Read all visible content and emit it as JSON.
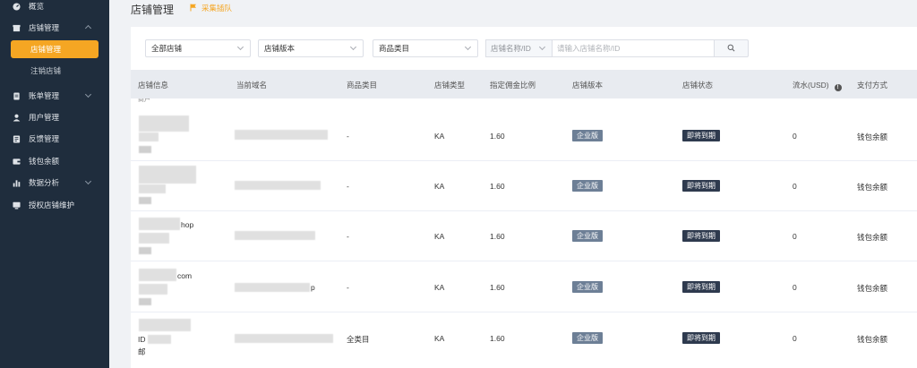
{
  "sidebar": {
    "items": [
      {
        "label": "概览",
        "icon": "dashboard-icon"
      },
      {
        "label": "店铺管理",
        "icon": "store-icon",
        "expanded": true,
        "children": [
          {
            "label": "店铺管理",
            "active": true
          },
          {
            "label": "注销店铺",
            "active": false
          }
        ]
      },
      {
        "label": "账单管理",
        "icon": "bill-icon",
        "expandable": true
      },
      {
        "label": "用户管理",
        "icon": "user-icon"
      },
      {
        "label": "反馈管理",
        "icon": "feedback-icon"
      },
      {
        "label": "钱包余额",
        "icon": "wallet-icon"
      },
      {
        "label": "数据分析",
        "icon": "chart-icon",
        "expandable": true
      },
      {
        "label": "授权店铺维护",
        "icon": "monitor-icon"
      }
    ],
    "active_color": "#f5a623",
    "bg_color": "#1f2d3d"
  },
  "header": {
    "title": "店铺管理",
    "collect_link": "采集插队"
  },
  "filters": {
    "all_stores": "全部店铺",
    "store_version": "店铺版本",
    "product_category": "商品类目",
    "search_type": "店铺名称/ID",
    "search_placeholder": "请输入店铺名称/ID"
  },
  "table": {
    "columns": [
      "店铺信息",
      "当前域名",
      "商品类目",
      "店铺类型",
      "指定佣金比例",
      "店铺版本",
      "店铺状态",
      "流水(USD)",
      "支付方式"
    ],
    "partial_top_text": "商户",
    "rows": [
      {
        "info_suffix": "",
        "domain_suffix": "",
        "category": "-",
        "type": "KA",
        "commission": "1.60",
        "version": "企业版",
        "status": "即将到期",
        "flow": "0",
        "payment": "钱包余额"
      },
      {
        "info_suffix": "",
        "domain_suffix": "",
        "category": "-",
        "type": "KA",
        "commission": "1.60",
        "version": "企业版",
        "status": "即将到期",
        "flow": "0",
        "payment": "钱包余额"
      },
      {
        "info_suffix": "hop",
        "domain_suffix": "",
        "category": "-",
        "type": "KA",
        "commission": "1.60",
        "version": "企业版",
        "status": "即将到期",
        "flow": "0",
        "payment": "钱包余额"
      },
      {
        "info_suffix": "com",
        "domain_suffix": "p",
        "category": "-",
        "type": "KA",
        "commission": "1.60",
        "version": "企业版",
        "status": "即将到期",
        "flow": "0",
        "payment": "钱包余额"
      },
      {
        "info_suffix": "",
        "info_line2": "ID",
        "info_line3": "邮",
        "domain_suffix": "",
        "category": "全类目",
        "type": "KA",
        "commission": "1.60",
        "version": "企业版",
        "status": "即将到期",
        "flow": "0",
        "payment": "钱包余额"
      }
    ]
  }
}
